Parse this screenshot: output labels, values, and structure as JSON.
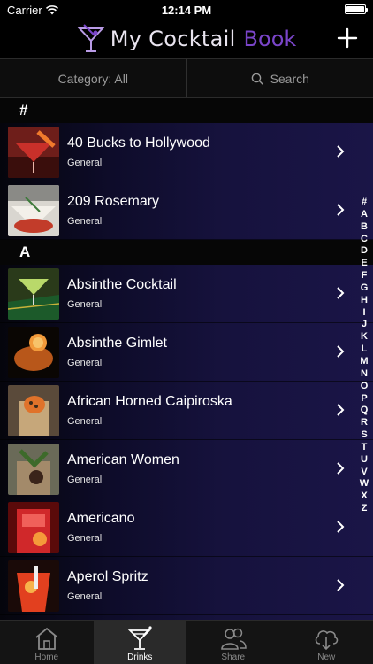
{
  "status": {
    "carrier": "Carrier",
    "time": "12:14 PM"
  },
  "nav": {
    "title_main": "My Cocktail",
    "title_accent": "Book"
  },
  "filters": {
    "category": "Category: All",
    "search": "Search"
  },
  "sections": [
    {
      "header": "#",
      "items": [
        {
          "name": "40 Bucks to Hollywood",
          "category": "General"
        },
        {
          "name": "209 Rosemary",
          "category": "General"
        }
      ]
    },
    {
      "header": "A",
      "items": [
        {
          "name": "Absinthe Cocktail",
          "category": "General"
        },
        {
          "name": "Absinthe Gimlet",
          "category": "General"
        },
        {
          "name": "African Horned Caipiroska",
          "category": "General"
        },
        {
          "name": "American Women",
          "category": "General"
        },
        {
          "name": "Americano",
          "category": "General"
        },
        {
          "name": "Aperol Spritz",
          "category": "General"
        }
      ]
    }
  ],
  "index": [
    "#",
    "A",
    "B",
    "C",
    "D",
    "E",
    "F",
    "G",
    "H",
    "I",
    "J",
    "K",
    "L",
    "M",
    "N",
    "O",
    "P",
    "Q",
    "R",
    "S",
    "T",
    "U",
    "V",
    "W",
    "X",
    "Z"
  ],
  "tabs": [
    {
      "label": "Home",
      "icon": "home-icon"
    },
    {
      "label": "Drinks",
      "icon": "cocktail-glass-icon",
      "active": true
    },
    {
      "label": "Share",
      "icon": "people-icon"
    },
    {
      "label": "New",
      "icon": "cloud-download-icon"
    }
  ],
  "colors": {
    "accent": "#7a45c9",
    "list_bg": "#16123d",
    "tab_active": "#2a2a2a"
  }
}
